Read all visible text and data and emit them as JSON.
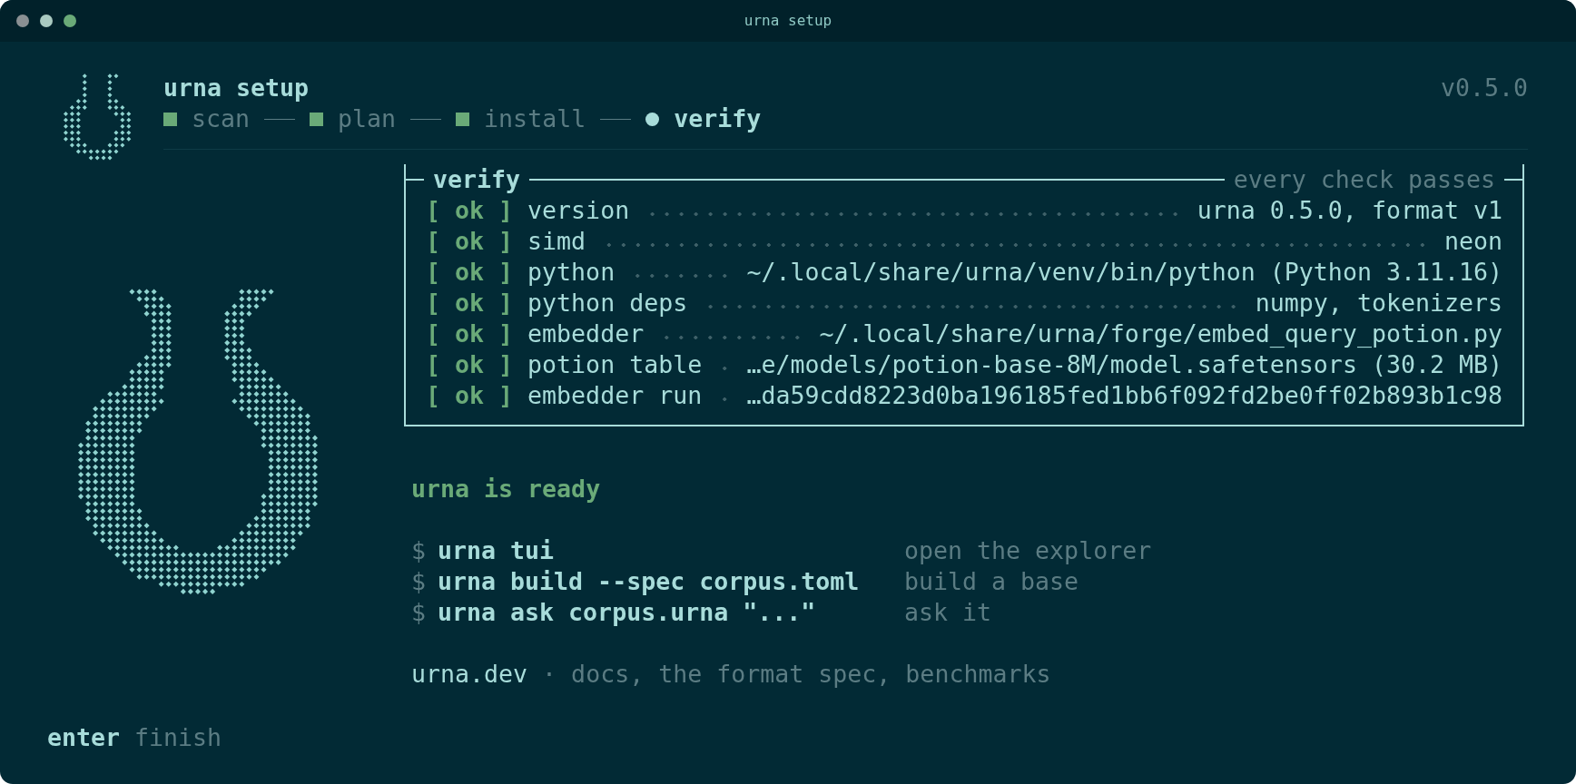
{
  "window": {
    "title": "urna setup",
    "controls": [
      {
        "color": "#8a9093"
      },
      {
        "color": "#a9c9c0"
      },
      {
        "color": "#6aaa78"
      }
    ]
  },
  "header": {
    "title": "urna setup",
    "version": "v0.5.0",
    "steps": [
      {
        "label": "scan",
        "current": false
      },
      {
        "label": "plan",
        "current": false
      },
      {
        "label": "install",
        "current": false
      },
      {
        "label": "verify",
        "current": true
      }
    ]
  },
  "checks": {
    "title": "verify",
    "summary": "every check passes",
    "rows": [
      {
        "status": "[ ok ]",
        "passed": true,
        "name": "version",
        "value": "urna 0.5.0, format v1"
      },
      {
        "status": "[ ok ]",
        "passed": true,
        "name": "simd",
        "value": "neon"
      },
      {
        "status": "[ ok ]",
        "passed": true,
        "name": "python",
        "value": "~/.local/share/urna/venv/bin/python (Python 3.11.16)"
      },
      {
        "status": "[ ok ]",
        "passed": true,
        "name": "python deps",
        "value": "numpy, tokenizers"
      },
      {
        "status": "[ ok ]",
        "passed": true,
        "name": "embedder",
        "value": "~/.local/share/urna/forge/embed_query_potion.py"
      },
      {
        "status": "[ ok ]",
        "passed": true,
        "name": "potion table",
        "value": "…e/models/potion-base-8M/model.safetensors (30.2 MB)"
      },
      {
        "status": "[ ok ]",
        "passed": true,
        "name": "embedder run",
        "value": "…da59cdd8223d0ba196185fed1bb6f092fd2be0ff02b893b1c98"
      }
    ]
  },
  "message": "urna is ready",
  "commands": [
    {
      "prompt": "$",
      "command": "urna tui",
      "description": "open the explorer"
    },
    {
      "prompt": "$",
      "command": "urna build --spec corpus.toml",
      "description": "build a base"
    },
    {
      "prompt": "$",
      "command": "urna ask corpus.urna \"...\"",
      "description": "ask it"
    }
  ],
  "links": {
    "link": "urna.dev",
    "text": "· docs, the format spec, benchmarks"
  },
  "keyhint": {
    "key": "enter",
    "action": "finish"
  }
}
